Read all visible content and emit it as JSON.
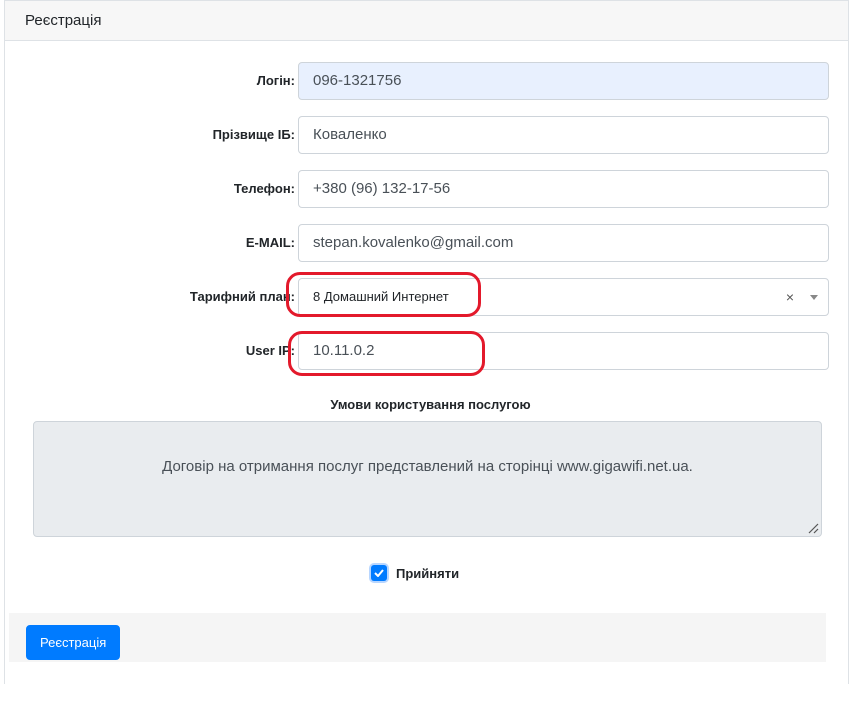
{
  "header": {
    "title": "Реєстрація"
  },
  "form": {
    "login": {
      "label": "Логін:",
      "value": "096-1321756"
    },
    "surname": {
      "label": "Прізвище ІБ:",
      "value": "Коваленко"
    },
    "phone": {
      "label": "Телефон:",
      "value": "+380 (96) 132-17-56"
    },
    "email": {
      "label": "E-MAIL:",
      "value": "stepan.kovalenko@gmail.com"
    },
    "tariff": {
      "label": "Тарифний план:",
      "value": "8 Домашний Интернет",
      "clear": "×"
    },
    "user_ip": {
      "label": "User IP:",
      "value": "10.11.0.2"
    }
  },
  "terms": {
    "title": "Умови користування послугою",
    "text": "Договір на отримання послуг представлений на сторінці www.gigawifi.net.ua."
  },
  "accept": {
    "label": "Прийняти",
    "checked": true
  },
  "footer": {
    "submit_label": "Реєстрація"
  },
  "colors": {
    "accent": "#007bff",
    "annotation": "#e3192b",
    "autofill": "#e8f0fe"
  }
}
